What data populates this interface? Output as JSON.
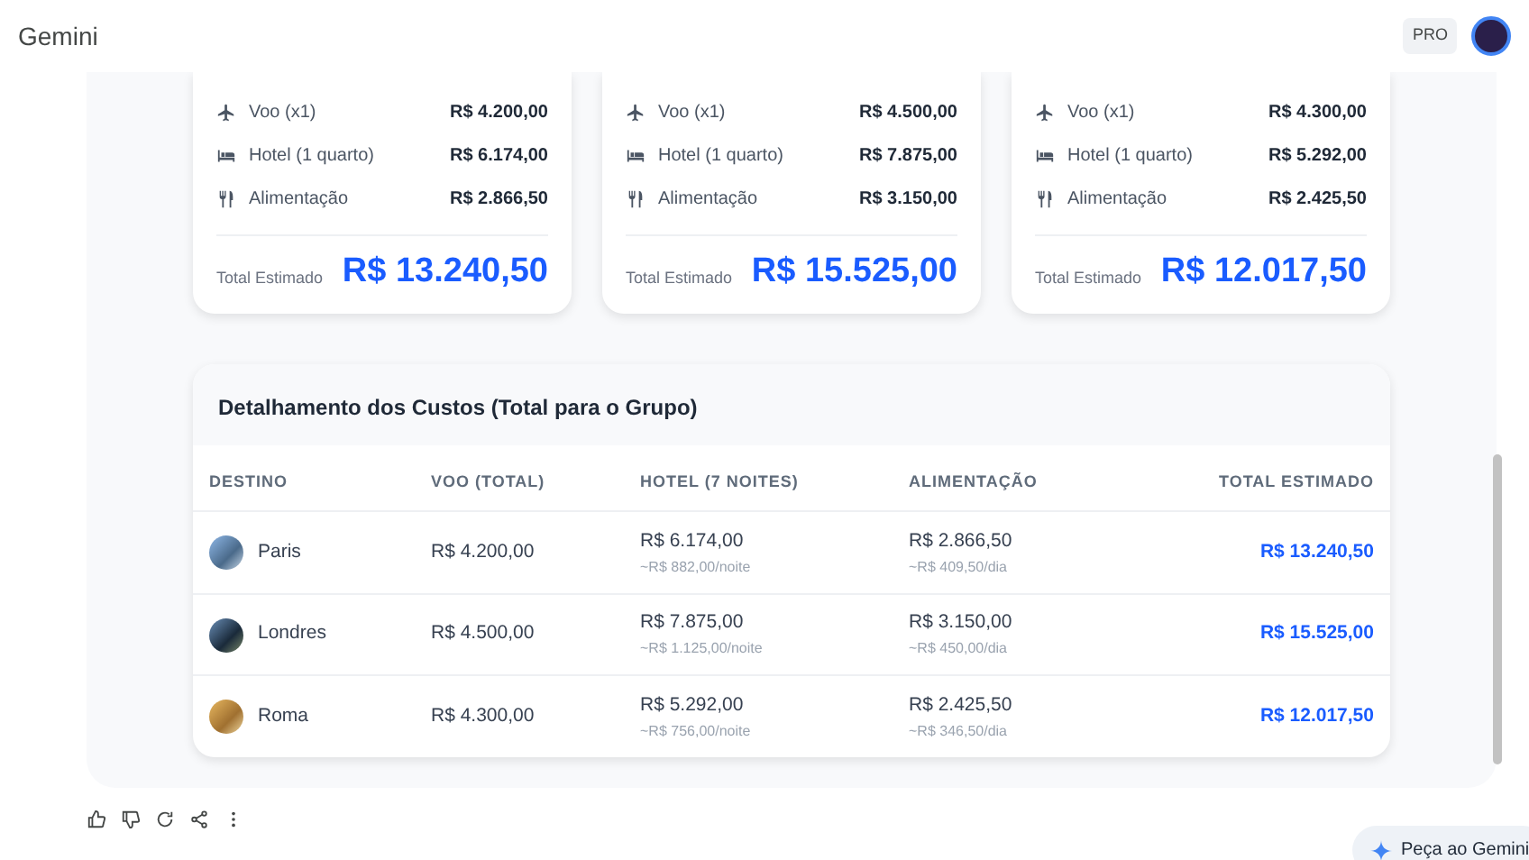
{
  "header": {
    "title": "Gemini",
    "badge": "PRO"
  },
  "cards": [
    {
      "items": [
        {
          "kind": "flight",
          "label": "Voo (x1)",
          "value": "R$ 4.200,00"
        },
        {
          "kind": "hotel",
          "label": "Hotel (1 quarto)",
          "value": "R$ 6.174,00"
        },
        {
          "kind": "food",
          "label": "Alimentação",
          "value": "R$ 2.866,50"
        }
      ],
      "total_label": "Total Estimado",
      "total": "R$ 13.240,50"
    },
    {
      "items": [
        {
          "kind": "flight",
          "label": "Voo (x1)",
          "value": "R$ 4.500,00"
        },
        {
          "kind": "hotel",
          "label": "Hotel (1 quarto)",
          "value": "R$ 7.875,00"
        },
        {
          "kind": "food",
          "label": "Alimentação",
          "value": "R$ 3.150,00"
        }
      ],
      "total_label": "Total Estimado",
      "total": "R$ 15.525,00"
    },
    {
      "items": [
        {
          "kind": "flight",
          "label": "Voo (x1)",
          "value": "R$ 4.300,00"
        },
        {
          "kind": "hotel",
          "label": "Hotel (1 quarto)",
          "value": "R$ 5.292,00"
        },
        {
          "kind": "food",
          "label": "Alimentação",
          "value": "R$ 2.425,50"
        }
      ],
      "total_label": "Total Estimado",
      "total": "R$ 12.017,50"
    }
  ],
  "table": {
    "title": "Detalhamento dos Custos (Total para o Grupo)",
    "columns": [
      "DESTINO",
      "VOO (TOTAL)",
      "HOTEL (7 NOITES)",
      "ALIMENTAÇÃO",
      "TOTAL ESTIMADO"
    ],
    "rows": [
      {
        "destino": "Paris",
        "voo": "R$ 4.200,00",
        "hotel": "R$ 6.174,00",
        "hotel_note": "~R$ 882,00/noite",
        "alimentacao": "R$ 2.866,50",
        "alimentacao_note": "~R$ 409,50/dia",
        "total": "R$ 13.240,50"
      },
      {
        "destino": "Londres",
        "voo": "R$ 4.500,00",
        "hotel": "R$ 7.875,00",
        "hotel_note": "~R$ 1.125,00/noite",
        "alimentacao": "R$ 3.150,00",
        "alimentacao_note": "~R$ 450,00/dia",
        "total": "R$ 15.525,00"
      },
      {
        "destino": "Roma",
        "voo": "R$ 4.300,00",
        "hotel": "R$ 5.292,00",
        "hotel_note": "~R$ 756,00/noite",
        "alimentacao": "R$ 2.425,50",
        "alimentacao_note": "~R$ 346,50/dia",
        "total": "R$ 12.017,50"
      }
    ]
  },
  "fab": {
    "label": "Peça ao Gemini"
  }
}
